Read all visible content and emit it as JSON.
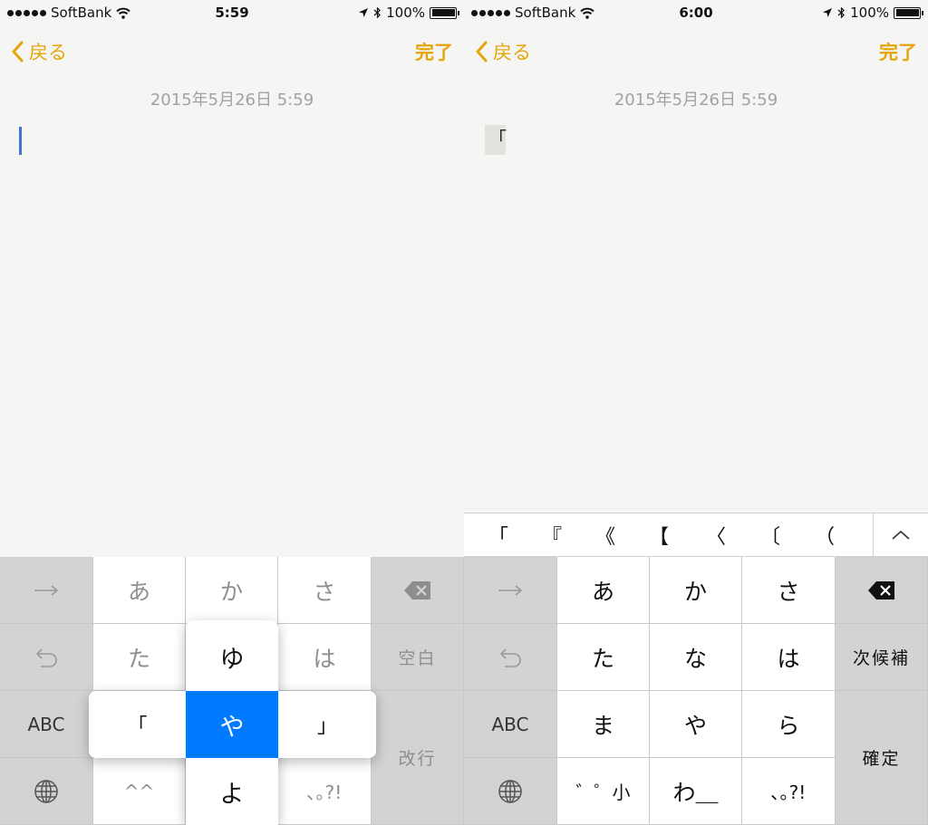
{
  "left": {
    "status": {
      "carrier": "SoftBank",
      "time": "5:59",
      "battery": "100%"
    },
    "nav": {
      "back": "戻る",
      "done": "完了"
    },
    "date": "2015年5月26日 5:59",
    "keyboard": {
      "row1": [
        "あ",
        "か",
        "さ"
      ],
      "row2": [
        "た",
        "ゆ",
        "は"
      ],
      "row3": [
        "ABC",
        "「",
        "や",
        "」"
      ],
      "row4": [
        "^^",
        "よ",
        "､｡?!"
      ],
      "space": "空白",
      "return": "改行"
    }
  },
  "right": {
    "status": {
      "carrier": "SoftBank",
      "time": "6:00",
      "battery": "100%"
    },
    "nav": {
      "back": "戻る",
      "done": "完了"
    },
    "date": "2015年5月26日 5:59",
    "typed_text": "「",
    "candidates": [
      "「",
      "『",
      "《",
      "【",
      "〈",
      "〔",
      "（"
    ],
    "keyboard": {
      "row1": [
        "あ",
        "か",
        "さ"
      ],
      "row2": [
        "た",
        "な",
        "は"
      ],
      "row3": [
        "ABC",
        "ま",
        "や",
        "ら"
      ],
      "row4": [
        "゛゜小",
        "わ＿",
        "､｡?!"
      ],
      "next_candidate": "次候補",
      "confirm": "確定"
    }
  },
  "colors": {
    "accent": "#e5a50a",
    "key_selected": "#007aff",
    "caret": "#3f74d7"
  },
  "icons": [
    "wifi-icon",
    "location-arrow-icon",
    "bluetooth-icon",
    "battery-icon",
    "chevron-left-icon",
    "arrow-right-icon",
    "undo-icon",
    "globe-icon",
    "delete-icon",
    "chevron-up-icon"
  ]
}
